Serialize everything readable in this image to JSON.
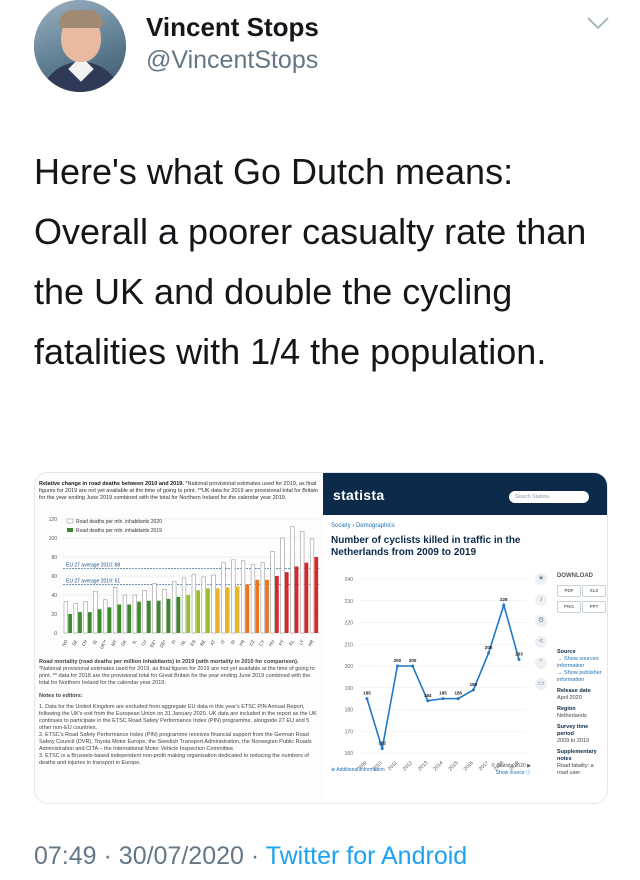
{
  "author": {
    "name": "Vincent Stops",
    "handle": "@VincentStops"
  },
  "tweet": {
    "text": "Here's what Go Dutch means: Overall a poorer casualty rate than the UK and double the cycling fatalities with 1/4 the population.",
    "time": "07:49",
    "date": "30/07/2020",
    "source": "Twitter for Android",
    "separator": "·"
  },
  "left_image": {
    "caption_bold": "Relative change in road deaths between 2010 and 2019.",
    "caption_rest": "*National provisional estimates used for 2019, as final figures for 2019 are not yet available at the time of going to print. **UK data for 2019 are provisional total for Britain for the year ending June 2019 combined with the total for Northern Ireland for the calendar year 2019.",
    "legend": [
      "Road deaths per mln. inhabitants 2020",
      "Road deaths per mln. inhabitants 2019"
    ],
    "avg_2010": "EU 27 average 2010: 68",
    "avg_2019": "EU 27 average 2019: 51",
    "notes_caption_bold": "Road mortality (road deaths per million inhabitants) in 2019 (with mortality in 2010 for comparison).",
    "notes_caption_rest": "*National provisional estimates used for 2019, as final figures for 2019 are not yet available at the time of going to print. ** data for 2018 are the provisional total for Great Britain for the year ending June 2019 combined with the total for Northern Ireland for the calendar year 2019.",
    "notes_heading": "Notes to editors:",
    "notes": [
      "1. Data for the United Kingdom are excluded from aggregate EU data in this year's ETSC PIN Annual Report, following the UK's exit from the European Union on 31 January 2020. UK data are included in the report as the UK continues to participate in the ETSC Road Safety Performance Index (PIN) programme, alongside 27 EU and 5 other non-EU countries.",
      "2. ETSC's Road Safety Performance Index (PIN) programme receives financial support from the German Road Safety Council (DVR), Toyota Motor Europe, the Swedish Transport Administration, the Norwegian Public Roads Administration and CITA – the International Motor Vehicle Inspection Committee.",
      "3. ETSC is a Brussels-based independent non-profit making organisation dedicated to reducing the numbers of deaths and injuries in transport in Europe."
    ]
  },
  "right_image": {
    "logo": "statista",
    "search_placeholder": "Search Statista",
    "breadcrumb": "Society › Demographics",
    "title": "Number of cyclists killed in traffic in the Netherlands from 2009 to 2019",
    "download_label": "DOWNLOAD",
    "download_buttons": [
      "PDF",
      "XLS",
      "PNG",
      "PPT"
    ],
    "source_heading": "Source",
    "source_links": [
      "→ Show sources information",
      "→ Show publisher information"
    ],
    "release_heading": "Release date",
    "release_value": "April 2020",
    "region_heading": "Region",
    "region_value": "Netherlands",
    "period_heading": "Survey time period",
    "period_value": "2009 to 2019",
    "supp_heading": "Supplementary notes",
    "supp_value": "Road fatality: a road user",
    "footer_left": "⊕ Additional Information",
    "footer_right_1": "© Statista 2020 ▶",
    "footer_right_2": "Show source ⓘ",
    "icon_names": [
      "star-icon",
      "bell-icon",
      "gear-icon",
      "share-icon",
      "quote-icon",
      "print-icon"
    ]
  },
  "chart_data": [
    {
      "type": "bar",
      "title": "Relative change in road deaths between 2010 and 2019.",
      "ylim": [
        0,
        120
      ],
      "yticks": [
        0,
        20,
        40,
        60,
        80,
        100,
        120
      ],
      "series": [
        {
          "name": "Road deaths per mln. inhabitants 2020",
          "values": [
            33,
            31,
            33,
            44,
            35,
            48,
            40,
            40,
            45,
            52,
            46,
            54,
            58,
            62,
            59,
            61,
            74,
            77,
            76,
            72,
            74,
            86,
            100,
            112,
            107,
            99
          ]
        },
        {
          "name": "Road deaths per mln. inhabitants 2019",
          "values": [
            20,
            22,
            22,
            25,
            27,
            30,
            30,
            33,
            34,
            34,
            36,
            38,
            40,
            45,
            47,
            47,
            48,
            49,
            51,
            56,
            56,
            60,
            64,
            70,
            74,
            80
          ]
        }
      ],
      "categories": [
        "NO",
        "SE",
        "CH",
        "IE",
        "UK**",
        "MT",
        "DK",
        "IL",
        "LU",
        "EE*",
        "DE*",
        "FI",
        "NL",
        "ES",
        "BE",
        "AT",
        "IT",
        "SI",
        "FR",
        "CZ",
        "CY",
        "HU",
        "PT",
        "EL",
        "LT",
        "HR"
      ],
      "reference_lines": [
        {
          "label": "EU 27 average 2010: 68",
          "value": 68
        },
        {
          "label": "EU 27 average 2019: 51",
          "value": 51
        }
      ]
    },
    {
      "type": "line",
      "title": "Number of cyclists killed in traffic in the Netherlands from 2009 to 2019",
      "x": [
        "2009",
        "2010",
        "2011",
        "2012",
        "2013",
        "2014",
        "2015",
        "2016",
        "2017",
        "2018",
        "2019"
      ],
      "values": [
        185,
        162,
        200,
        200,
        184,
        185,
        185,
        189,
        206,
        228,
        203
      ],
      "ylim": [
        160,
        240
      ],
      "yticks": [
        160,
        170,
        180,
        190,
        200,
        210,
        220,
        230,
        240
      ]
    }
  ]
}
